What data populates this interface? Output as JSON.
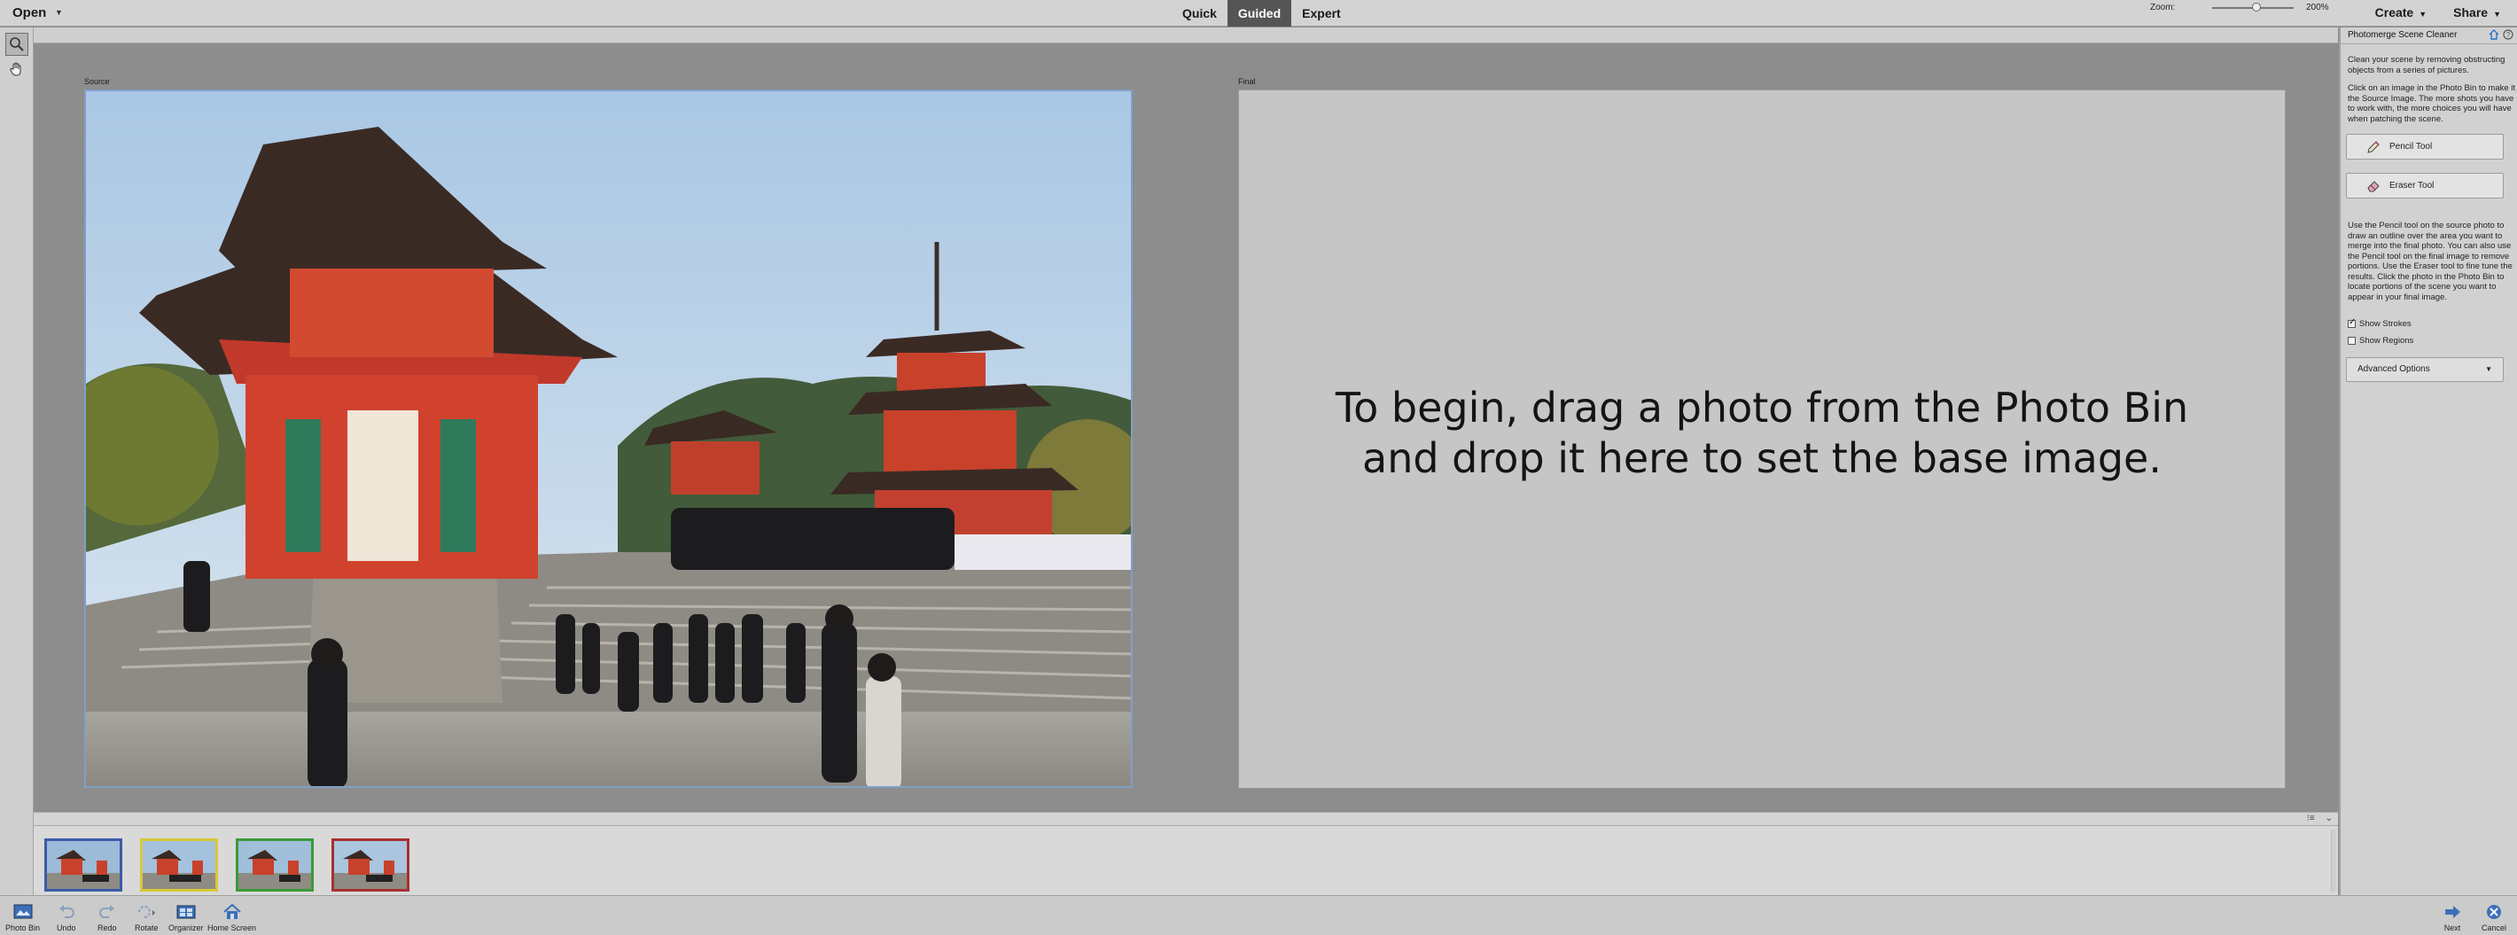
{
  "topbar": {
    "open_label": "Open",
    "modes": [
      {
        "label": "Quick",
        "active": false
      },
      {
        "label": "Guided",
        "active": true
      },
      {
        "label": "Expert",
        "active": false
      }
    ],
    "create_label": "Create",
    "share_label": "Share"
  },
  "tools": {
    "zoom_icon": "magnifier-icon",
    "hand_icon": "hand-icon"
  },
  "zoom": {
    "label": "Zoom:",
    "value": "200%",
    "slider_fraction": 0.5
  },
  "canvas": {
    "source_label": "Source",
    "final_label": "Final",
    "drop_hint_line1": "To begin, drag a photo from the Photo Bin",
    "drop_hint_line2": "and drop it here to set the base image."
  },
  "right_panel": {
    "title": "Photomerge Scene Cleaner",
    "intro": "Clean your scene by removing obstructing objects from a series of pictures.",
    "instructions": "Click on an image in the Photo Bin to make it the Source Image. The more shots you have to work with, the more choices you will have when patching the scene.",
    "pencil_tool_label": "Pencil Tool",
    "eraser_tool_label": "Eraser Tool",
    "usage": "Use the Pencil tool on the source photo to draw an outline over the area you want to merge into the final photo. You can also use the Pencil tool on the final image to remove portions. Use the Eraser tool to fine tune the results. Click the photo in the Photo Bin to locate portions of the scene you want to appear in your final image.",
    "show_strokes_label": "Show Strokes",
    "show_strokes_checked": true,
    "show_regions_label": "Show Regions",
    "show_regions_checked": false,
    "advanced_options_label": "Advanced Options"
  },
  "photo_bin": {
    "thumbnails": [
      {
        "border_color": "#3456b0"
      },
      {
        "border_color": "#d8c838"
      },
      {
        "border_color": "#3a9a3a"
      },
      {
        "border_color": "#a83030"
      }
    ]
  },
  "taskbar": {
    "items": [
      {
        "label": "Photo Bin",
        "icon": "photo-bin-icon"
      },
      {
        "label": "Undo",
        "icon": "undo-icon"
      },
      {
        "label": "Redo",
        "icon": "redo-icon"
      },
      {
        "label": "Rotate",
        "icon": "rotate-icon"
      },
      {
        "label": "Organizer",
        "icon": "organizer-icon"
      },
      {
        "label": "Home Screen",
        "icon": "home-icon"
      }
    ],
    "next_label": "Next",
    "cancel_label": "Cancel"
  },
  "colors": {
    "accent": "#2f6fc4",
    "active_mode_bg": "#555555",
    "source_frame": "#7f9fc9"
  }
}
